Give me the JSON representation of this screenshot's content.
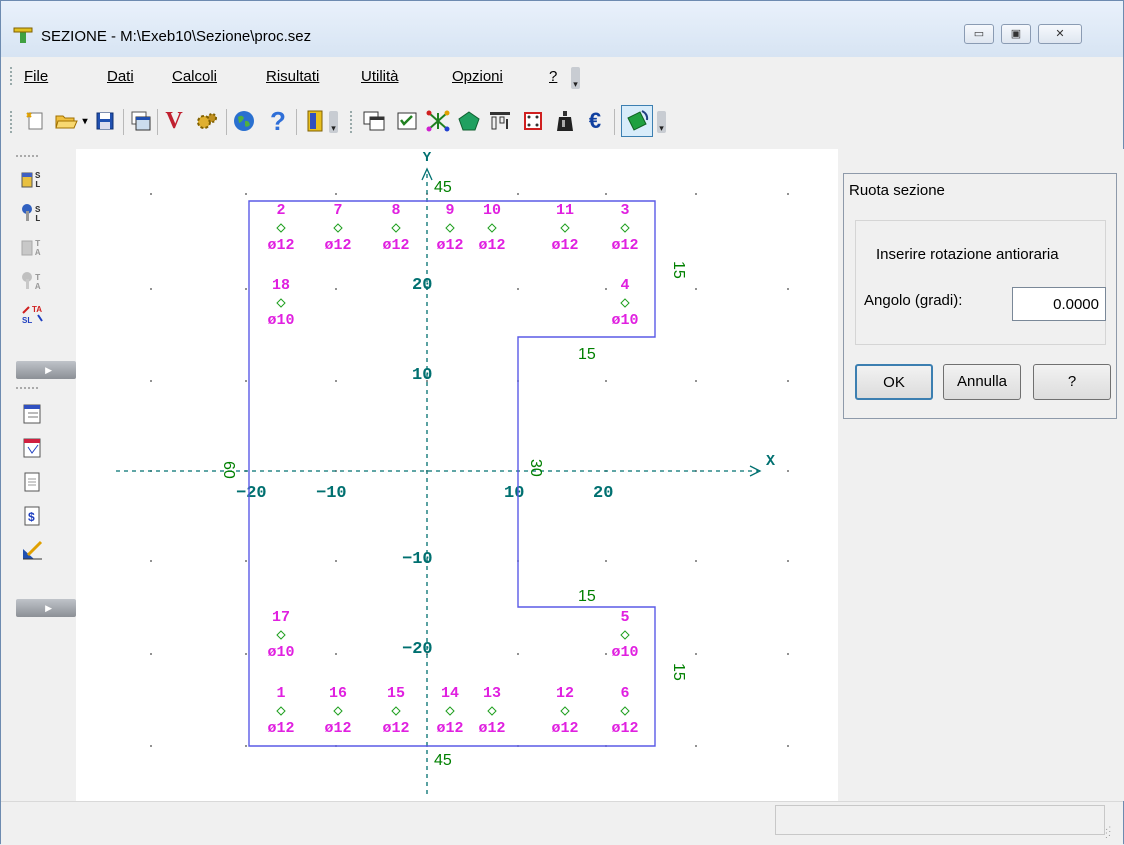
{
  "window": {
    "title": "SEZIONE - M:\\Exeb10\\Sezione\\proc.sez",
    "minimize_label": "▭",
    "maximize_label": "▣",
    "close_label": "✕"
  },
  "menu": {
    "items": [
      {
        "label": "File"
      },
      {
        "label": "Dati"
      },
      {
        "label": "Calcoli"
      },
      {
        "label": "Risultati"
      },
      {
        "label": "Utilità"
      },
      {
        "label": "Opzioni"
      },
      {
        "label": "?"
      }
    ]
  },
  "toolbar": {
    "icons": [
      "new-file-icon",
      "open-folder-icon",
      "dropdown-arrow-icon",
      "save-icon",
      "windows-icon",
      "verify-icon",
      "gears-icon",
      "globe-icon",
      "help-icon",
      "exit-door-icon",
      "overlay-icon",
      "checklist-icon",
      "network-icon",
      "pentagon-icon",
      "beam-icon",
      "frame-icon",
      "weight-icon",
      "euro-icon",
      "rotate-section-icon"
    ],
    "verify_glyph": "V",
    "help_glyph": "?",
    "euro_glyph": "€"
  },
  "left_toolbar": {
    "icons": [
      "section-sl-icon",
      "key-sl-icon",
      "section-ta-icon",
      "key-ta-icon",
      "ta-sl-convert-icon",
      "table-report-icon",
      "flag-report-icon",
      "document-icon",
      "dollar-icon",
      "drawing-tool-icon"
    ]
  },
  "colors": {
    "outline": "#5a5ae6",
    "bar_label": "#e020e0",
    "axis": "#007070",
    "dimension": "#008000",
    "grid_dot": "#707070"
  },
  "drawing": {
    "axis_x_label": "X",
    "axis_y_label": "Y",
    "x_ticks": [
      "−20",
      "−10",
      "10",
      "20"
    ],
    "y_ticks": [
      "20",
      "10",
      "−10",
      "−20"
    ],
    "dims": {
      "top": "45",
      "bottom": "45",
      "right_top": "15",
      "right_bottom": "15",
      "notch_top": "15",
      "notch_bottom": "15",
      "left": "60",
      "notch_side": "30"
    },
    "bars": [
      {
        "id": "2",
        "dia": "ø12"
      },
      {
        "id": "7",
        "dia": "ø12"
      },
      {
        "id": "8",
        "dia": "ø12"
      },
      {
        "id": "9",
        "dia": "ø12"
      },
      {
        "id": "10",
        "dia": "ø12"
      },
      {
        "id": "11",
        "dia": "ø12"
      },
      {
        "id": "3",
        "dia": "ø12"
      },
      {
        "id": "18",
        "dia": "ø10"
      },
      {
        "id": "4",
        "dia": "ø10"
      },
      {
        "id": "17",
        "dia": "ø10"
      },
      {
        "id": "5",
        "dia": "ø10"
      },
      {
        "id": "1",
        "dia": "ø12"
      },
      {
        "id": "16",
        "dia": "ø12"
      },
      {
        "id": "15",
        "dia": "ø12"
      },
      {
        "id": "14",
        "dia": "ø12"
      },
      {
        "id": "13",
        "dia": "ø12"
      },
      {
        "id": "12",
        "dia": "ø12"
      },
      {
        "id": "6",
        "dia": "ø12"
      }
    ]
  },
  "dialog": {
    "title": "Ruota sezione",
    "prompt": "Inserire rotazione antioraria",
    "angle_label": "Angolo (gradi):",
    "angle_value": "0.0000",
    "ok_label": "OK",
    "cancel_label": "Annulla",
    "help_label": "?"
  }
}
